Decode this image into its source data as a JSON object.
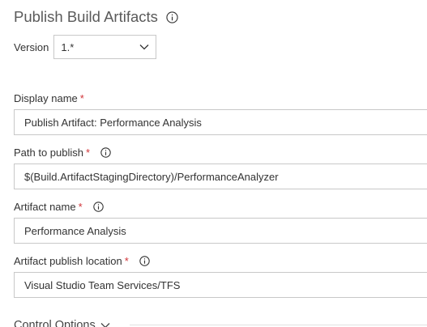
{
  "task": {
    "title": "Publish Build Artifacts"
  },
  "version": {
    "label": "Version",
    "value": "1.*"
  },
  "fields": {
    "display_name": {
      "label": "Display name",
      "required_mark": "*",
      "value": "Publish Artifact: Performance Analysis"
    },
    "path_to_publish": {
      "label": "Path to publish",
      "required_mark": "*",
      "value": "$(Build.ArtifactStagingDirectory)/PerformanceAnalyzer"
    },
    "artifact_name": {
      "label": "Artifact name",
      "required_mark": "*",
      "value": "Performance Analysis"
    },
    "artifact_publish_location": {
      "label": "Artifact publish location",
      "required_mark": "*",
      "value": "Visual Studio Team Services/TFS"
    }
  },
  "sections": {
    "control_options": "Control Options"
  },
  "icons": {
    "info": "info-icon",
    "chevron": "chevron-down-icon"
  },
  "colors": {
    "required": "#d13438",
    "border": "#c8c8c8"
  }
}
